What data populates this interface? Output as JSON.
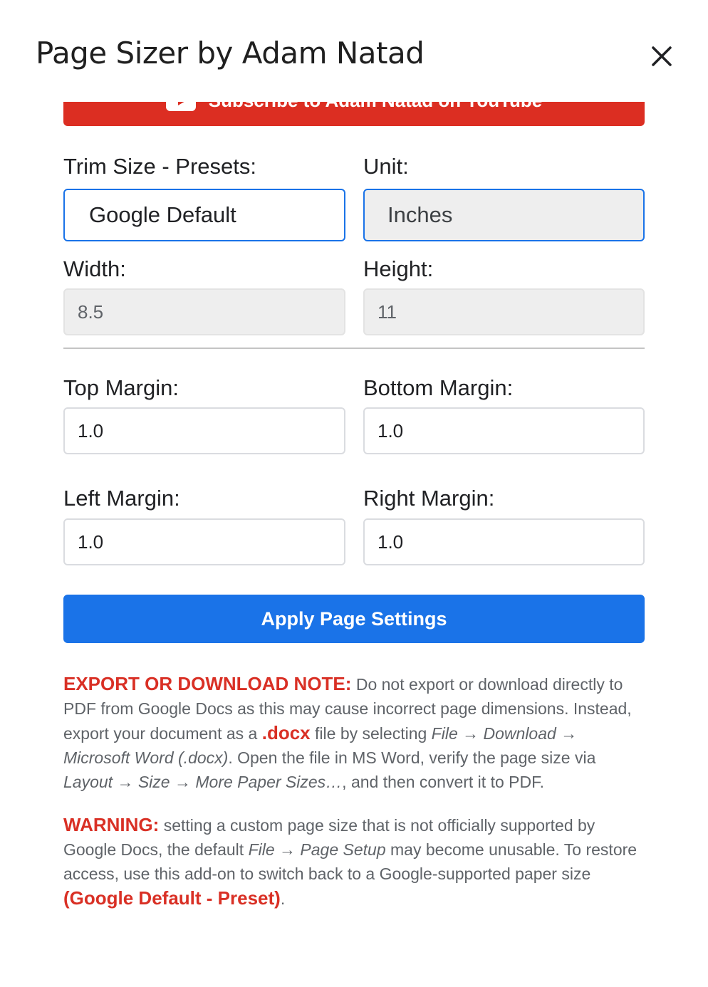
{
  "dialog": {
    "title": "Page Sizer by Adam Natad",
    "close_icon": "close-icon"
  },
  "banner": {
    "label": "Subscribe to Adam Natad on YouTube",
    "icon": "youtube-icon",
    "color": "#dc2e22"
  },
  "form": {
    "trim_label": "Trim Size - Presets:",
    "trim_value": "Google Default",
    "unit_label": "Unit:",
    "unit_value": "Inches",
    "width_label": "Width:",
    "width_value": "8.5",
    "height_label": "Height:",
    "height_value": "11",
    "top_margin_label": "Top Margin:",
    "top_margin_value": "1.0",
    "bottom_margin_label": "Bottom Margin:",
    "bottom_margin_value": "1.0",
    "left_margin_label": "Left Margin:",
    "left_margin_value": "1.0",
    "right_margin_label": "Right Margin:",
    "right_margin_value": "1.0",
    "apply_label": "Apply Page Settings",
    "accent": "#1a73e8"
  },
  "export_note": {
    "heading": "EXPORT OR DOWNLOAD NOTE:",
    "t1": " Do not export or download directly to PDF from Google Docs as this may cause incorrect page dimensions. Instead, export your document as a ",
    "docx": ".docx",
    "t2": " file by selecting ",
    "path1": "File → Download → Microsoft Word (.docx)",
    "t3": ". Open the file in MS Word, verify the page size via ",
    "path2": "Layout → Size → More Paper Sizes…",
    "t4": ", and then convert it to PDF."
  },
  "warning": {
    "heading": "WARNING:",
    "t1": " setting a custom page size that is not officially supported by Google Docs, the default ",
    "path": "File → Page Setup",
    "t2": " may become unusable. To restore access, use this add-on to switch back to a Google-supported paper size ",
    "preset": "(Google Default - Preset)",
    "t3": ".",
    "color": "#d93025"
  }
}
